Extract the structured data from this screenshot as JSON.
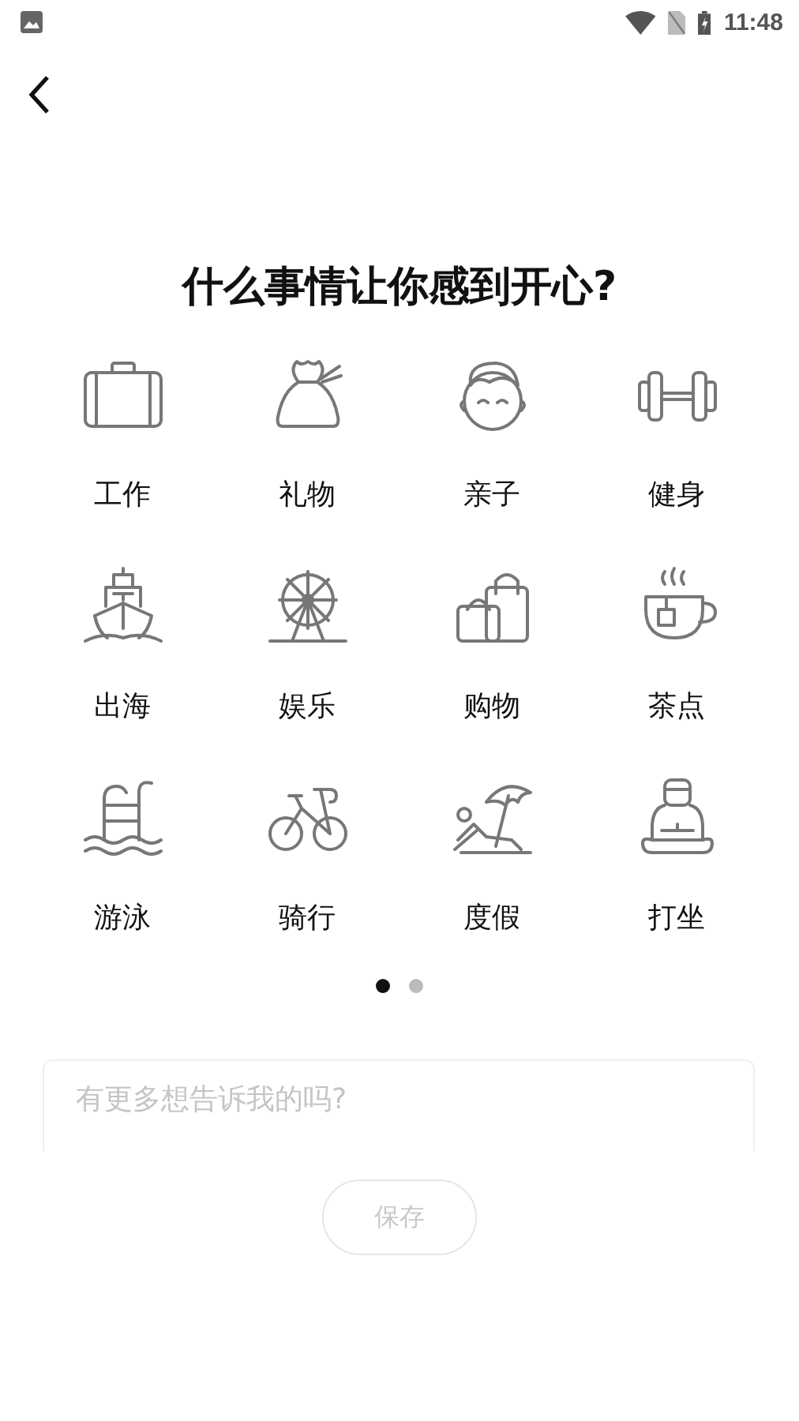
{
  "status_bar": {
    "time": "11:48"
  },
  "title": "什么事情让你感到开心?",
  "categories": [
    {
      "label": "工作",
      "kind": "briefcase"
    },
    {
      "label": "礼物",
      "kind": "gift"
    },
    {
      "label": "亲子",
      "kind": "baby"
    },
    {
      "label": "健身",
      "kind": "dumbbell"
    },
    {
      "label": "出海",
      "kind": "ship"
    },
    {
      "label": "娱乐",
      "kind": "ferris"
    },
    {
      "label": "购物",
      "kind": "bags"
    },
    {
      "label": "茶点",
      "kind": "tea"
    },
    {
      "label": "游泳",
      "kind": "pool"
    },
    {
      "label": "骑行",
      "kind": "bike"
    },
    {
      "label": "度假",
      "kind": "beach"
    },
    {
      "label": "打坐",
      "kind": "meditate"
    }
  ],
  "pages": [
    {
      "selected": true
    },
    {
      "selected": false
    }
  ],
  "note_field": {
    "placeholder": "有更多想告诉我的吗?"
  },
  "save_button": {
    "label": "保存",
    "disabled": true
  }
}
